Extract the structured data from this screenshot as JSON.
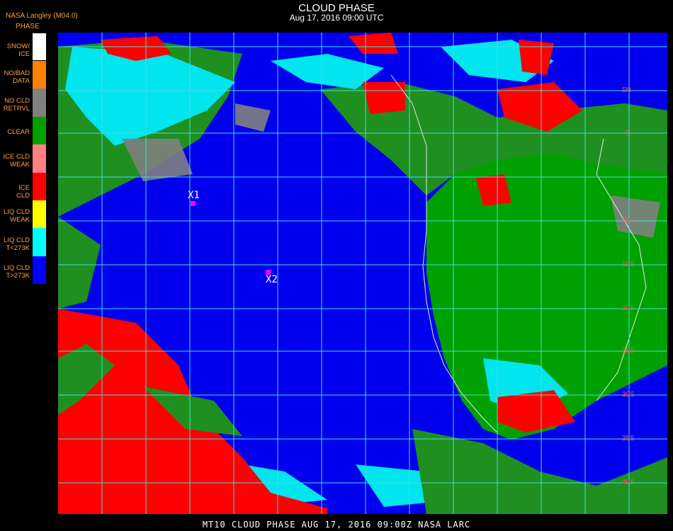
{
  "header": {
    "title": "CLOUD PHASE",
    "datetime": "Aug 17, 2016 09:00 UTC",
    "source": "NASA Langley (M04.0)",
    "legend_title": "PHASE"
  },
  "legend": [
    {
      "label": "SNOW/ ICE",
      "color": "#ffffff"
    },
    {
      "label": "NO/BAD DATA",
      "color": "#ff8000"
    },
    {
      "label": "NO CLD RETRVL",
      "color": "#808080"
    },
    {
      "label": "CLEAR",
      "color": "#00a000"
    },
    {
      "label": "ICE CLD WEAK",
      "color": "#ff8080"
    },
    {
      "label": "ICE CLD",
      "color": "#ff0000"
    },
    {
      "label": "LIQ CLD WEAK",
      "color": "#ffff00"
    },
    {
      "label": "LIQ CLD T<273K",
      "color": "#00ffff"
    },
    {
      "label": "LIQ CLD T>273K",
      "color": "#0000ff"
    }
  ],
  "markers": [
    {
      "label": "X1"
    },
    {
      "label": "X2"
    }
  ],
  "grid_labels": [
    "5N",
    "0",
    "10S",
    "15S",
    "20S",
    "25S",
    "30S",
    "35S",
    "40S"
  ],
  "footer": "MT10 CLOUD PHASE AUG 17, 2016 09:00Z NASA LARC"
}
